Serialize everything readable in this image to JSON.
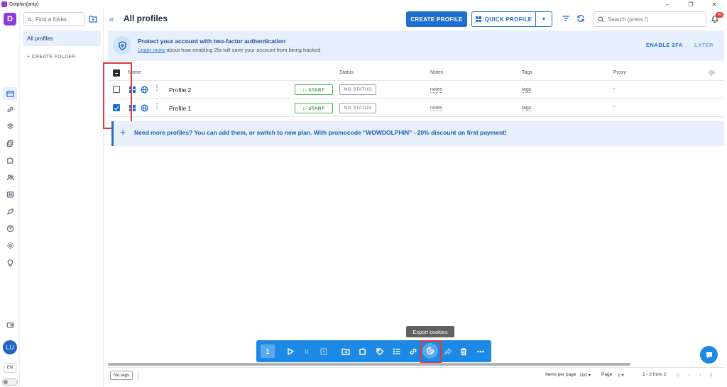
{
  "window": {
    "title": "Dolphin{anty}",
    "controls": [
      "–",
      "❐",
      "✕"
    ]
  },
  "sidebar": {
    "logo": "D",
    "icons": [
      "browser-profiles-icon",
      "link-icon",
      "extensions-icon",
      "copy-icon",
      "puzzle-icon",
      "users-icon",
      "api-icon",
      "rocket-icon",
      "help-icon",
      "settings-icon",
      "lightbulb-icon"
    ],
    "avatar": "LU",
    "language": "EN"
  },
  "folders": {
    "search_placeholder": "Find a folder",
    "all_profiles": "All profiles",
    "create_folder": "+ CREATE FOLDER"
  },
  "header": {
    "collapse": "«",
    "title": "All profiles",
    "create_profile": "CREATE PROFILE",
    "quick_profile": "QUICK PROFILE",
    "search_placeholder": "Search (press /)",
    "notifications_count": "90"
  },
  "banner": {
    "title": "Protect your account with two-factor authentication",
    "learn_more": "Learn more",
    "subtitle_rest": " about how enabling 2fa will save your account from being hacked",
    "enable": "ENABLE 2FA",
    "later": "LATER"
  },
  "table": {
    "columns": {
      "name": "Name",
      "status": "Status",
      "notes": "Notes",
      "tags": "Tags",
      "proxy": "Proxy"
    },
    "header_checkbox": "indeterminate",
    "rows": [
      {
        "name": "Profile 2",
        "start": "▷ START",
        "status": "NO STATUS",
        "notes": "notes",
        "tags": "tags",
        "proxy": "-",
        "checked": false
      },
      {
        "name": "Profile 1",
        "start": "▷ START",
        "status": "NO STATUS",
        "notes": "notes",
        "tags": "tags",
        "proxy": "-",
        "checked": true
      }
    ]
  },
  "promo": {
    "plus": "+",
    "text": "Need more profiles? You can add them, or switch to new plan. With promocode \"WOWDOLPHIN\" - 20% discount on first payment!"
  },
  "actionbar": {
    "selected_count": "1",
    "tooltip": "Export cookies",
    "icons": [
      "play-icon",
      "pause-icon",
      "import-icon",
      "move-to-folder-icon",
      "extension-icon",
      "tag-icon",
      "list-icon",
      "link-icon",
      "cookie-icon",
      "share-icon",
      "trash-icon",
      "more-icon"
    ],
    "active": "cookie-icon"
  },
  "footer": {
    "no_tags": "No tags",
    "items_per_page_label": "Items per page",
    "items_per_page_value": "100",
    "page_label": "Page",
    "page_value": "1",
    "range": "1 - 2 from 2",
    "pager": [
      "|‹",
      "‹",
      "›",
      "›|"
    ]
  },
  "colors": {
    "accent": "#1e6fd0",
    "highlight": "#e53935",
    "brand": "#8b3ddb",
    "start": "#3a9d3e"
  }
}
